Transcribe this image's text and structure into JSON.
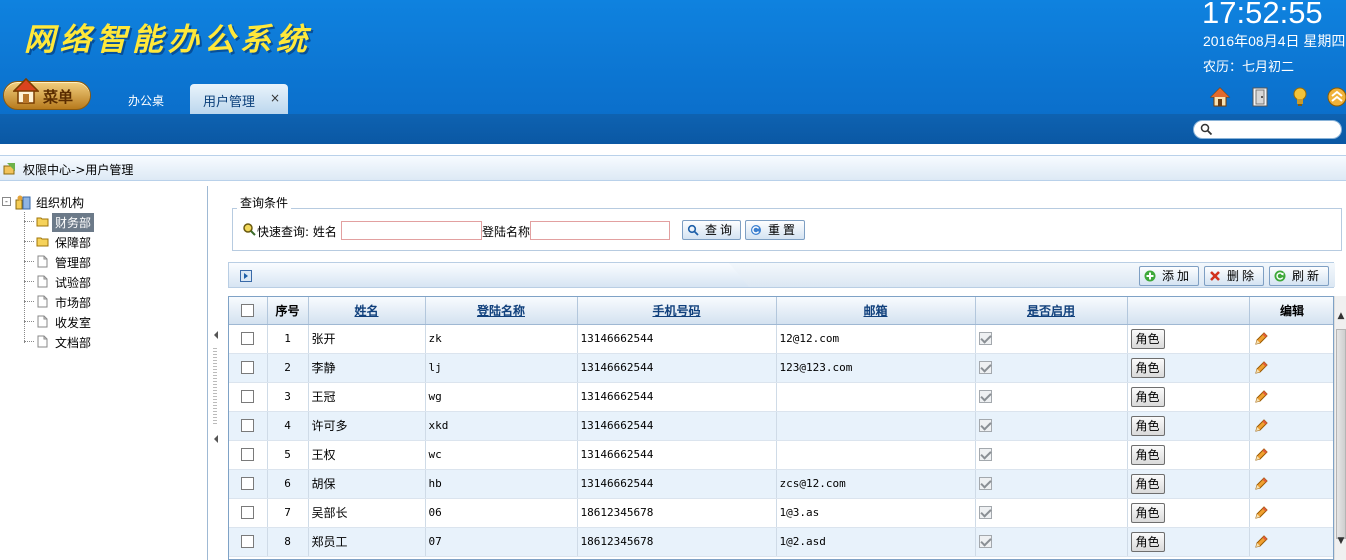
{
  "header": {
    "logo_text": "网络智能办公系统",
    "clock": "17:52:55",
    "date": "2016年08月4日 星期四",
    "lunar": "农历：七月初二",
    "menu_label": "菜单",
    "tabs": [
      {
        "label": "办公桌"
      },
      {
        "label": "用户管理",
        "close": "×"
      }
    ],
    "search_placeholder": ""
  },
  "breadcrumb": {
    "text": "权限中心->用户管理"
  },
  "tree": {
    "root": {
      "label": "组织机构",
      "toggle": "-"
    },
    "items": [
      {
        "label": "财务部",
        "selected": true
      },
      {
        "label": "保障部"
      },
      {
        "label": "管理部"
      },
      {
        "label": "试验部"
      },
      {
        "label": "市场部"
      },
      {
        "label": "收发室"
      },
      {
        "label": "文档部"
      }
    ]
  },
  "query": {
    "title": "查询条件",
    "quick_label": "快速查询: 姓名",
    "login_label": "登陆名称",
    "name_value": "",
    "login_value": "",
    "search_button": "查询",
    "reset_button": "重置"
  },
  "toolbar": {
    "add": "添加",
    "delete": "删除",
    "refresh": "刷新"
  },
  "table": {
    "headers": {
      "no": "序号",
      "name": "姓名",
      "login": "登陆名称",
      "phone": "手机号码",
      "email": "邮箱",
      "enabled": "是否启用",
      "role": "",
      "edit": "编辑"
    },
    "role_label": "角色",
    "rows": [
      {
        "no": "1",
        "name": "张开",
        "login": "zk",
        "phone": "13146662544",
        "email": "12@12.com",
        "enabled": true
      },
      {
        "no": "2",
        "name": "李静",
        "login": "lj",
        "phone": "13146662544",
        "email": "123@123.com",
        "enabled": true
      },
      {
        "no": "3",
        "name": "王冠",
        "login": "wg",
        "phone": "13146662544",
        "email": "",
        "enabled": true
      },
      {
        "no": "4",
        "name": "许可多",
        "login": "xkd",
        "phone": "13146662544",
        "email": "",
        "enabled": true
      },
      {
        "no": "5",
        "name": "王权",
        "login": "wc",
        "phone": "13146662544",
        "email": "",
        "enabled": true
      },
      {
        "no": "6",
        "name": "胡保",
        "login": "hb",
        "phone": "13146662544",
        "email": "zcs@12.com",
        "enabled": true
      },
      {
        "no": "7",
        "name": "吴部长",
        "login": "06",
        "phone": "18612345678",
        "email": "1@3.as",
        "enabled": true
      },
      {
        "no": "8",
        "name": "郑员工",
        "login": "07",
        "phone": "18612345678",
        "email": "1@2.asd",
        "enabled": true
      }
    ]
  }
}
